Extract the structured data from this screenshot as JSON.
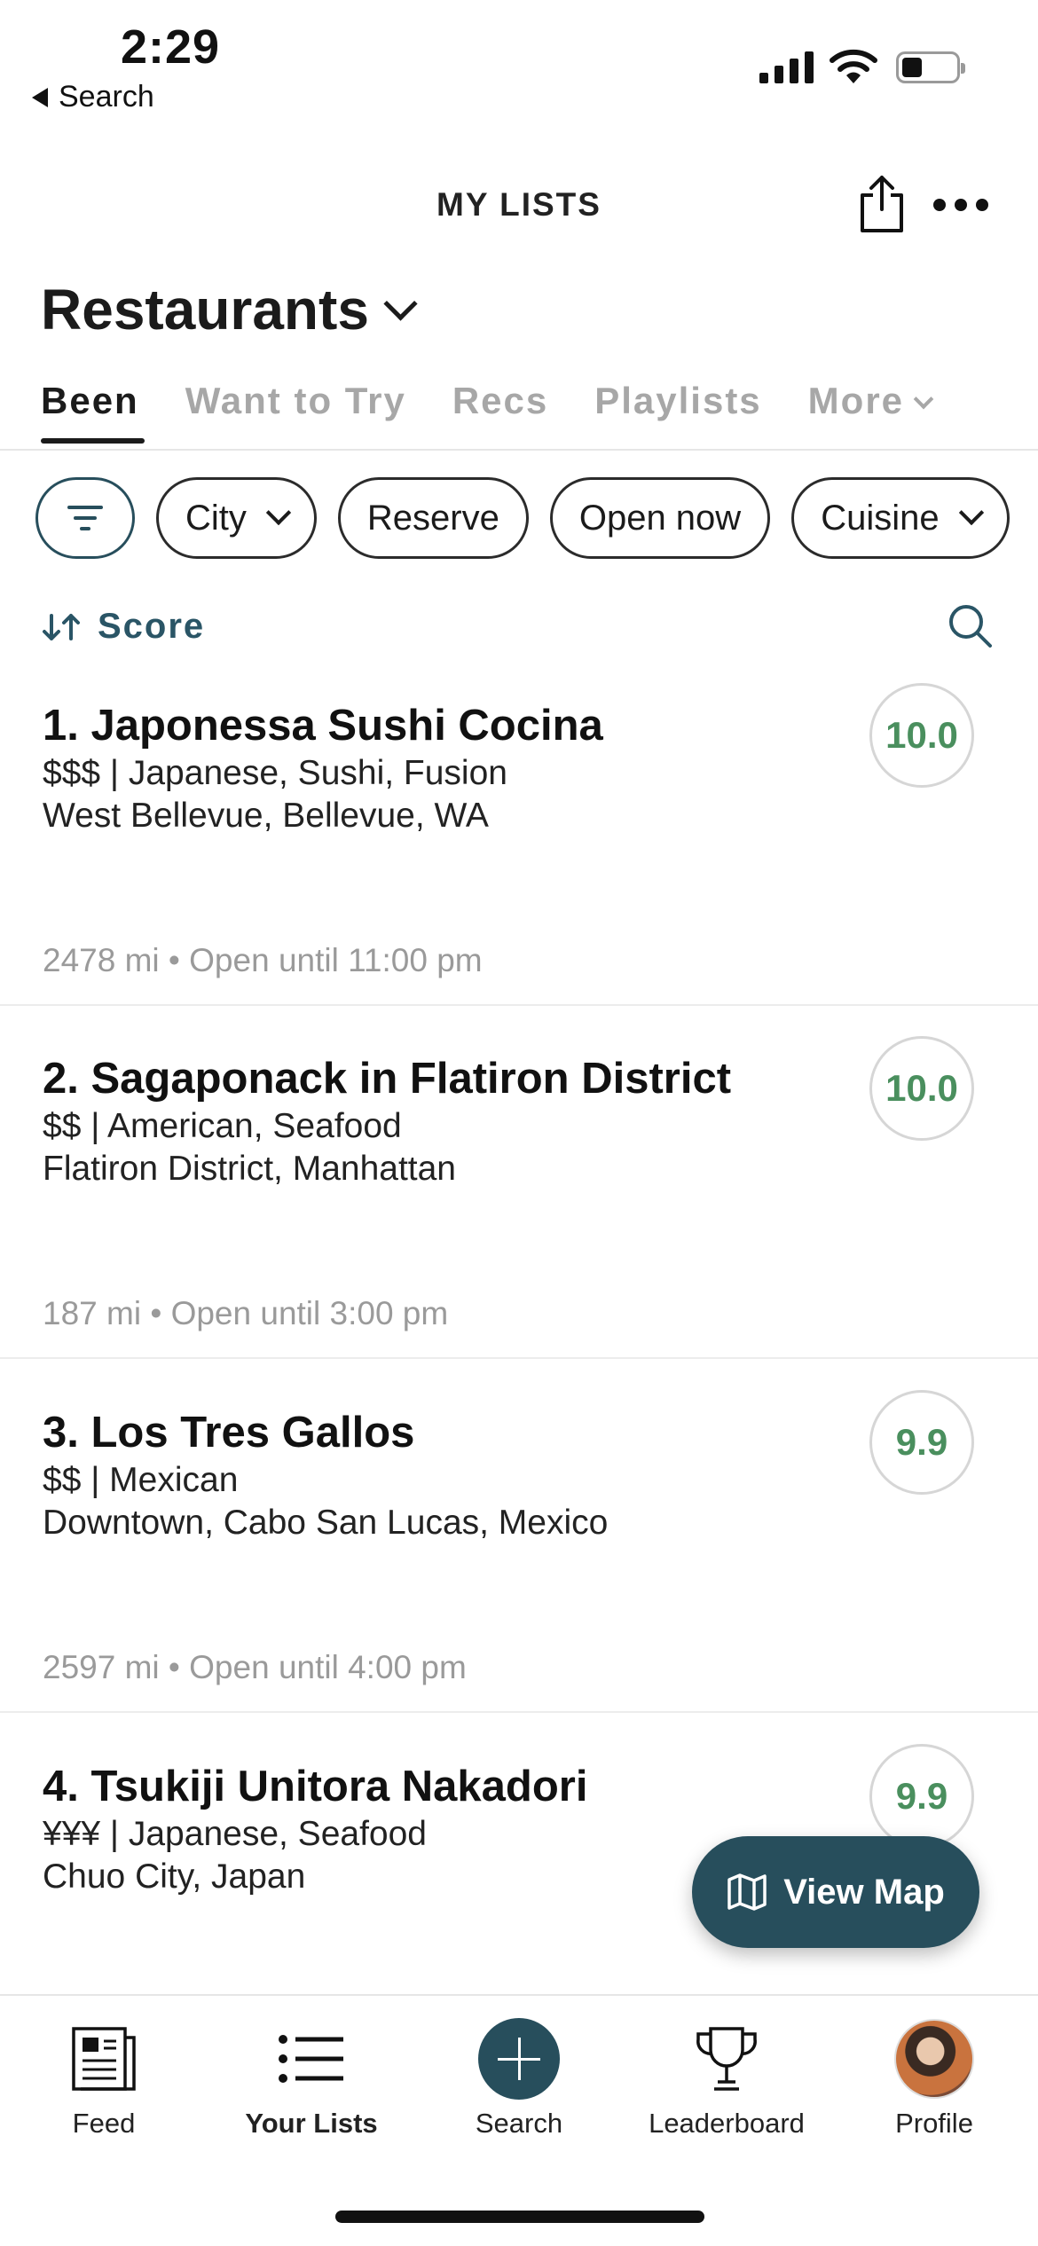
{
  "status_bar": {
    "time": "2:29",
    "back_label": "Search"
  },
  "header": {
    "title": "MY LISTS"
  },
  "list": {
    "title": "Restaurants"
  },
  "tabs": [
    {
      "label": "Been",
      "active": true
    },
    {
      "label": "Want to Try"
    },
    {
      "label": "Recs"
    },
    {
      "label": "Playlists"
    },
    {
      "label": "More"
    }
  ],
  "chips": [
    "City",
    "Reserve",
    "Open now",
    "Cuisine"
  ],
  "sort": {
    "label": "Score"
  },
  "items": [
    {
      "name": "1. Japonessa Sushi Cocina",
      "meta": "$$$ | Japanese, Sushi, Fusion",
      "location": "West Bellevue, Bellevue, WA",
      "distance": "2478 mi • Open until 11:00 pm",
      "score": "10.0"
    },
    {
      "name": "2. Sagaponack in Flatiron District",
      "meta": "$$ | American, Seafood",
      "location": "Flatiron District, Manhattan",
      "distance": "187 mi • Open until 3:00 pm",
      "score": "10.0"
    },
    {
      "name": "3. Los Tres Gallos",
      "meta": "$$ | Mexican",
      "location": "Downtown, Cabo San Lucas, Mexico",
      "distance": "2597 mi • Open until 4:00 pm",
      "score": "9.9"
    },
    {
      "name": "4. Tsukiji Unitora Nakadori",
      "meta": "¥¥¥ | Japanese, Seafood",
      "location": "Chuo City, Japan",
      "score": "9.9"
    }
  ],
  "view_map": {
    "label": "View Map"
  },
  "nav": [
    {
      "label": "Feed",
      "icon": "newspaper-icon"
    },
    {
      "label": "Your Lists",
      "icon": "list-icon",
      "active": true
    },
    {
      "label": "Search",
      "icon": "plus-icon"
    },
    {
      "label": "Leaderboard",
      "icon": "trophy-icon"
    },
    {
      "label": "Profile",
      "icon": "avatar"
    }
  ],
  "colors": {
    "accent": "#274e5c",
    "score_green": "#4a8f5e",
    "muted": "#a7a7a7"
  }
}
